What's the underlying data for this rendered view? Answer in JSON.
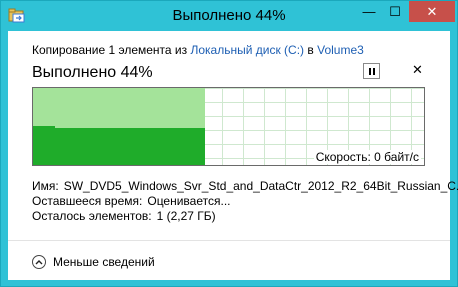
{
  "window": {
    "title": "Выполнено 44%",
    "minimize_glyph": "—",
    "maximize_glyph": "☐",
    "close_glyph": "✕",
    "icons": {
      "app": "folder-copy-icon",
      "pause": "pause-icon",
      "cancel": "close-icon",
      "toggle": "chevron-up-icon"
    }
  },
  "copy": {
    "prefix": "Копирование 1 элемента из",
    "source": "Локальный диск (C:)",
    "middle": "в",
    "destination": "Volume3"
  },
  "progress": {
    "title": "Выполнено 44%",
    "percent": 44,
    "cancel_glyph": "✕"
  },
  "speed": {
    "text": "Скорость: 0 байт/с"
  },
  "details": {
    "name_label": "Имя:",
    "name_value": "SW_DVD5_Windows_Svr_Std_and_DataCtr_2012_R2_64Bit_Russian_C...",
    "time_label": "Оставшееся время:",
    "time_value": "Оценивается...",
    "items_label": "Осталось элементов:",
    "items_value": "1 (2,27 ГБ)"
  },
  "footer": {
    "less_details": "Меньше сведений"
  },
  "colors": {
    "frame": "#2fc2d6",
    "close_button": "#c7504a",
    "link": "#1e5fb3",
    "graph_progress": "#a4e39a",
    "graph_speed": "#1fac2a",
    "graph_grid": "#cfe8cf"
  }
}
